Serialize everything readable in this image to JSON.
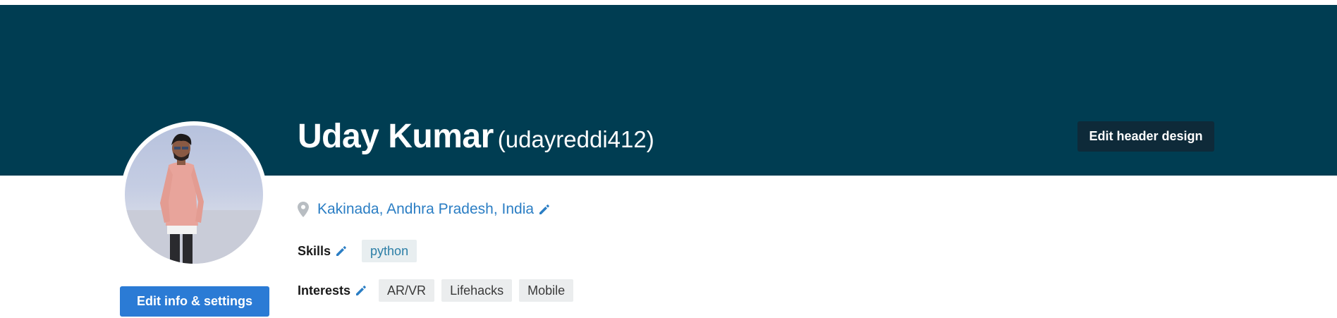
{
  "profile": {
    "full_name": "Uday Kumar",
    "username": "(udayreddi412)",
    "location": "Kakinada, Andhra Pradesh, India",
    "avatar_icon": "user-photo"
  },
  "header": {
    "background_color": "#003d52",
    "edit_header_label": "Edit header design"
  },
  "skills": {
    "label": "Skills",
    "items": [
      "python"
    ]
  },
  "interests": {
    "label": "Interests",
    "items": [
      "AR/VR",
      "Lifehacks",
      "Mobile"
    ]
  },
  "actions": {
    "edit_info_label": "Edit info & settings"
  },
  "colors": {
    "link": "#2b7ec4",
    "primary_button": "#2b7bd5",
    "dark_button": "#0e2a39"
  },
  "icons": {
    "location": "map-pin-icon",
    "edit": "pencil-icon"
  }
}
